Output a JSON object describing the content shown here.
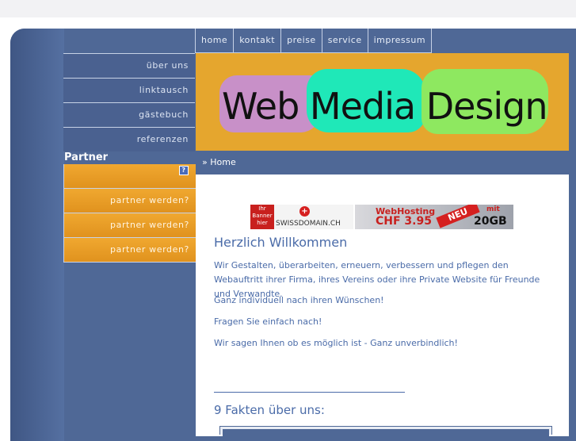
{
  "top_nav": [
    "home",
    "kontakt",
    "preise",
    "service",
    "impressum"
  ],
  "side_nav": [
    "über uns",
    "linktausch",
    "gästebuch",
    "referenzen"
  ],
  "partner": {
    "title": "Partner",
    "items": [
      "partner werden?",
      "partner werden?",
      "partner werden?"
    ],
    "help_icon": "question-icon"
  },
  "header": {
    "logo_words": [
      "Web",
      "Media",
      "Design"
    ],
    "bg_color": "#e5a62e"
  },
  "breadcrumb": "» Home",
  "banners": {
    "left_red": "Ihr Banner hier",
    "swissdomain": "SWISSDOMAIN.CH",
    "webhosting_title": "WebHosting",
    "webhosting_price": "CHF 3.95",
    "neu": "NEU",
    "mit": "mit",
    "gb": "20GB"
  },
  "main": {
    "heading": "Herzlich Willkommen",
    "paragraphs": [
      "Wir Gestalten, überarbeiten, erneuern, verbessern und pflegen den Webauftritt ihrer Firma, ihres Vereins oder ihre Private Website für Freunde und Verwandte.",
      "Ganz individuell nach ihren Wünschen!",
      "Fragen Sie einfach nach!",
      "Wir sagen Ihnen ob es möglich ist - Ganz unverbindlich!"
    ],
    "facts_heading": "9 Fakten über uns:"
  },
  "colors": {
    "frame": "#4f6896",
    "accent_orange": "#e8a024",
    "text_blue": "#4a6ba8"
  }
}
